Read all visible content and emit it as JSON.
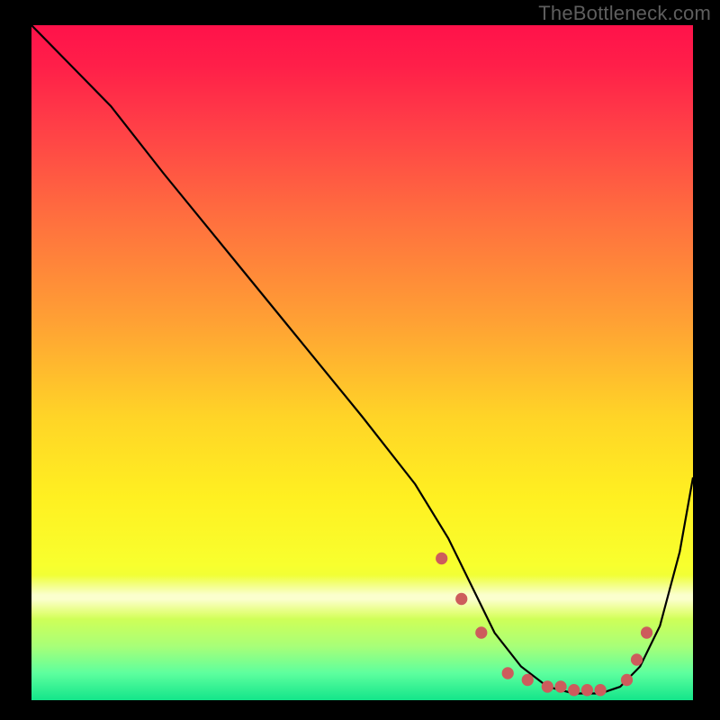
{
  "watermark": "TheBottleneck.com",
  "chart_data": {
    "type": "line",
    "title": "",
    "xlabel": "",
    "ylabel": "",
    "xlim": [
      0,
      100
    ],
    "ylim": [
      0,
      100
    ],
    "grid": false,
    "legend": false,
    "series": [
      {
        "name": "curve",
        "color": "#000000",
        "x": [
          0,
          2,
          6,
          12,
          20,
          30,
          40,
          50,
          58,
          63,
          67,
          70,
          74,
          78,
          82,
          86,
          89,
          92,
          95,
          98,
          100
        ],
        "values": [
          100,
          98,
          94,
          88,
          78,
          66,
          54,
          42,
          32,
          24,
          16,
          10,
          5,
          2,
          1,
          1,
          2,
          5,
          11,
          22,
          33
        ]
      }
    ],
    "markers": {
      "name": "dots",
      "color": "#cd5c5c",
      "x": [
        62,
        65,
        68,
        72,
        75,
        78,
        80,
        82,
        84,
        86,
        90,
        91.5,
        93
      ],
      "values": [
        21,
        15,
        10,
        4,
        3,
        2,
        2,
        1.5,
        1.5,
        1.5,
        3,
        6,
        10
      ]
    }
  }
}
